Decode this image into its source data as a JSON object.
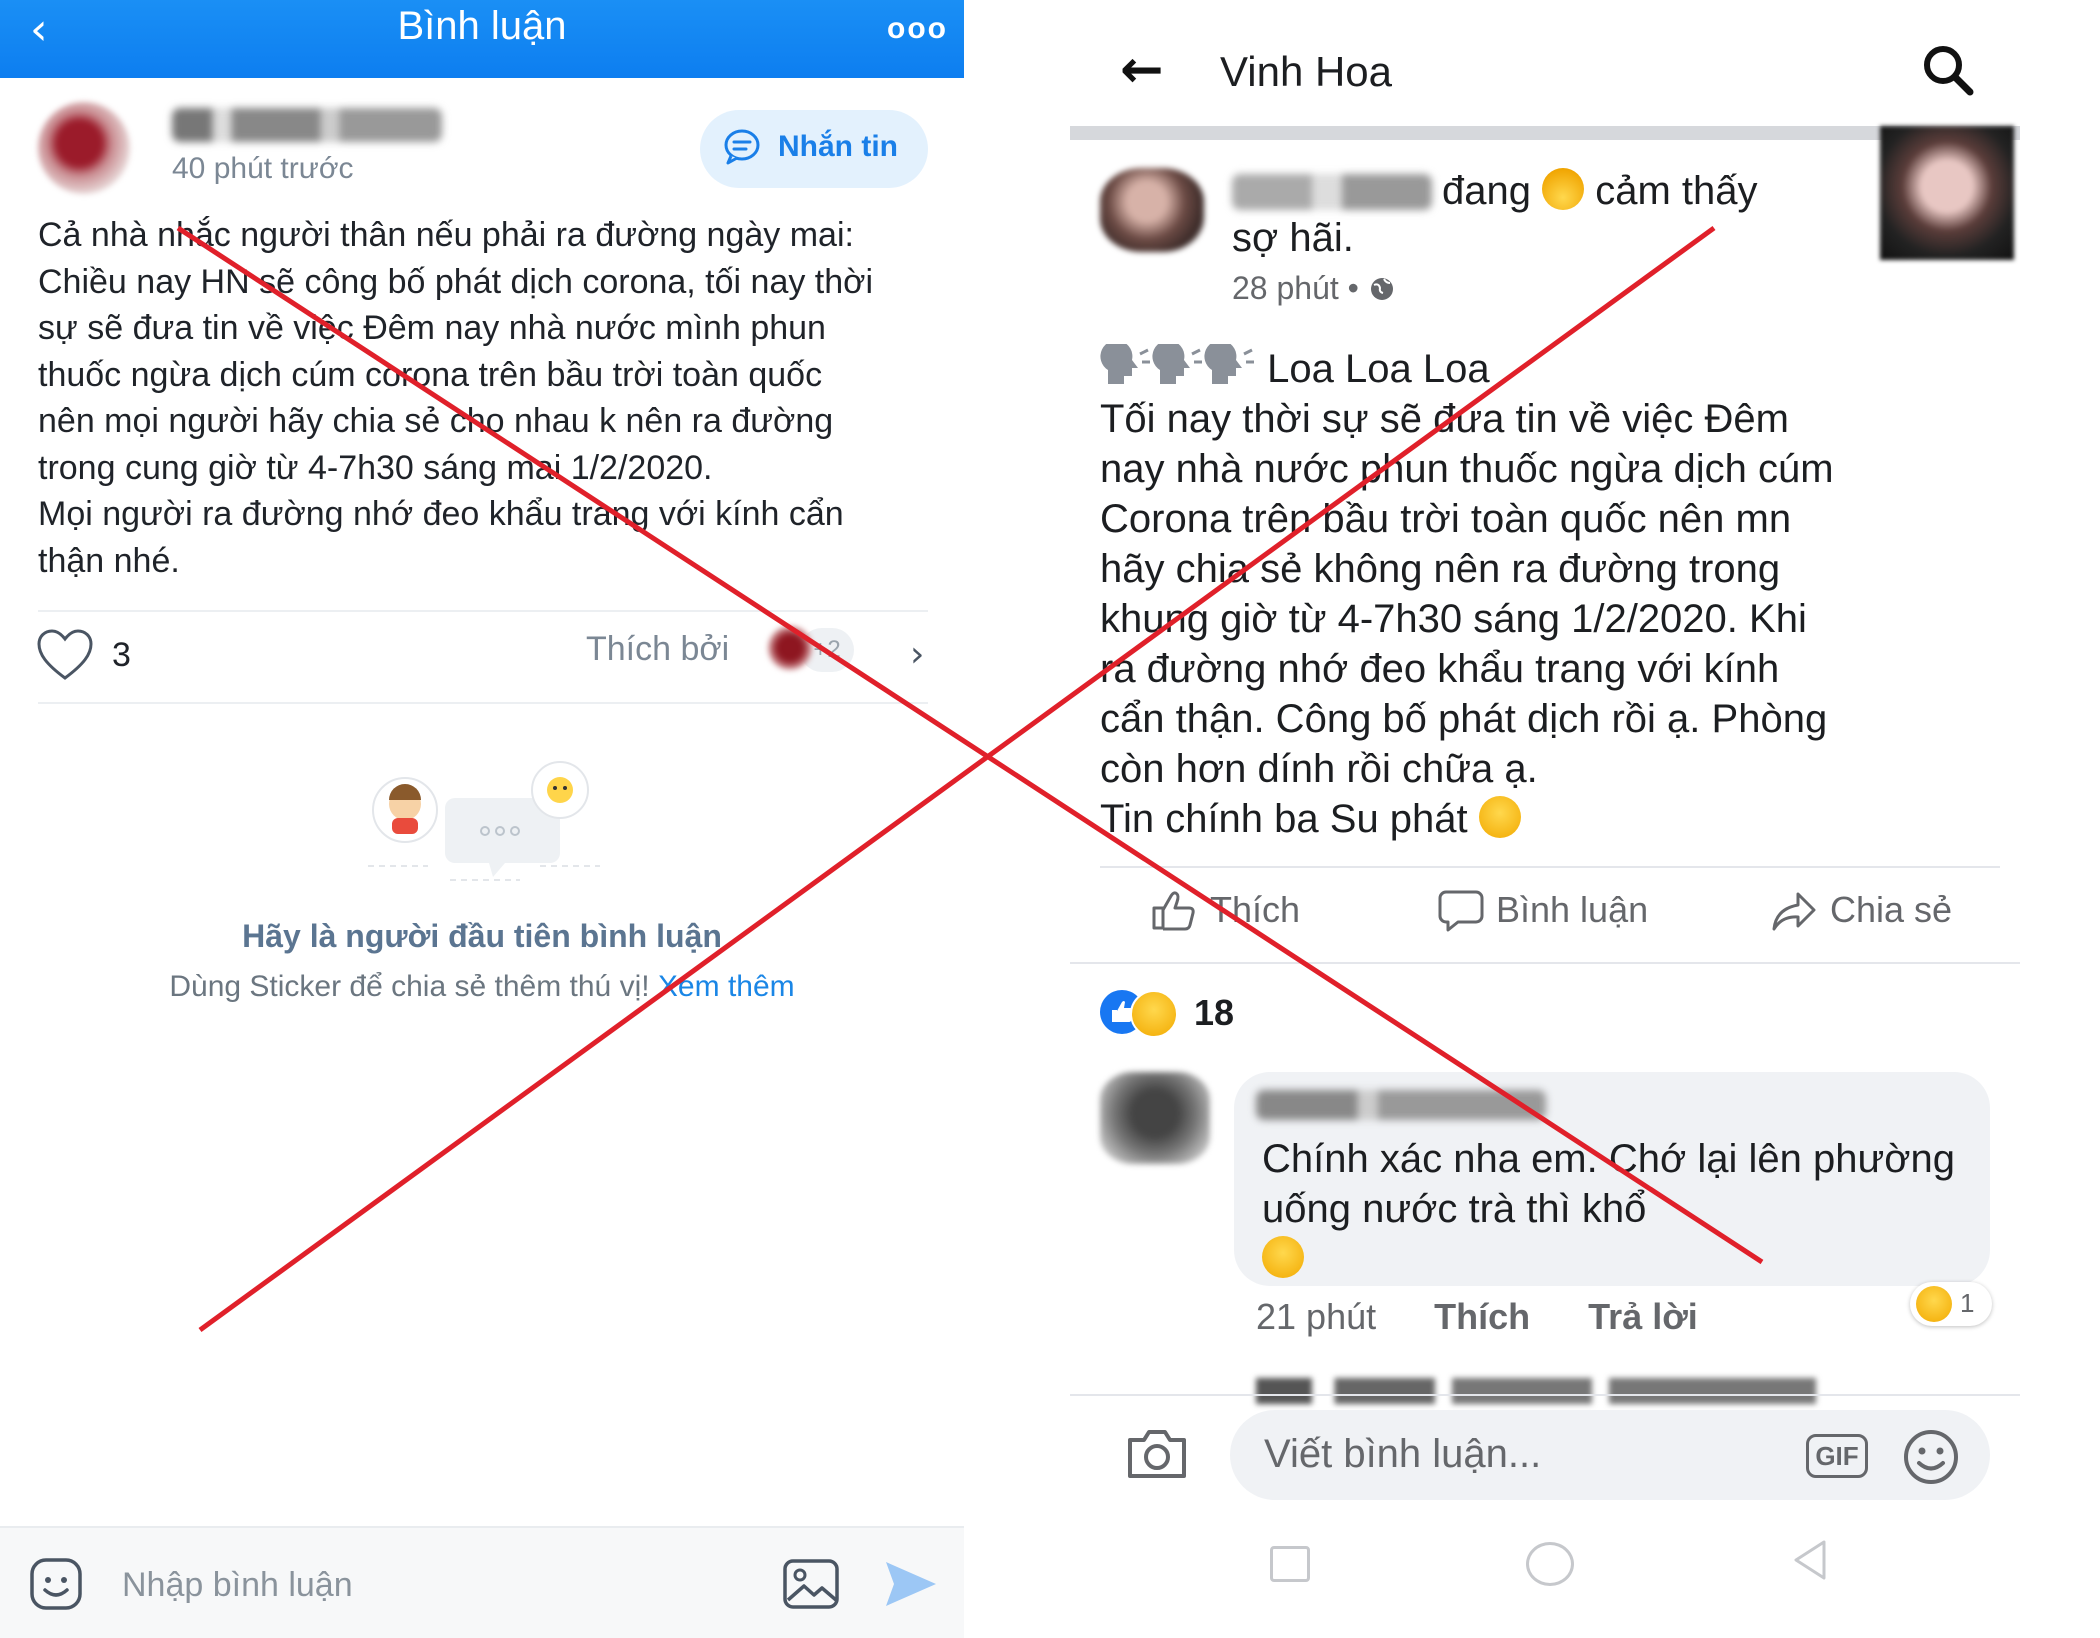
{
  "left_panel": {
    "header": {
      "back_glyph": "‹",
      "title": "Bình luận",
      "more_glyph": "ooo"
    },
    "post": {
      "time": "40 phút trước",
      "message_button_label": "Nhắn tin",
      "body": "Cả nhà nhắc người thân nếu phải ra đường ngày mai:\nChiều nay HN sẽ công bố phát dịch corona, tối nay thời\nsự sẽ đưa tin về việc Đêm nay nhà nước mình phun\nthuốc ngừa dịch cúm corona trên bầu trời toàn quốc\nnên mọi người hãy chia sẻ cho nhau k nên ra đường\ntrong cung giờ từ 4-7h30 sáng mai 1/2/2020.\nMọi người ra đường nhớ đeo khẩu trang với kính cẩn\nthận nhé.",
      "like_count": "3",
      "liked_by_label": "Thích bởi",
      "liked_by_more": "+2",
      "chevron_glyph": "›"
    },
    "empty_state": {
      "title": "Hãy là người đầu tiên bình luận",
      "subtitle": "Dùng Sticker để chia sẻ thêm thú vị!",
      "link": "Xem thêm"
    },
    "footer": {
      "input_placeholder": "Nhập bình luận"
    }
  },
  "right_panel": {
    "header": {
      "back_glyph": "←",
      "title": "Vinh Hoa"
    },
    "post": {
      "status_prefix": "đang",
      "status_feeling": "cảm thấy",
      "status_line2": "sợ hãi.",
      "time": "28 phút •",
      "heading": "Loa Loa Loa",
      "body_lines": [
        "Tối nay thời sự sẽ đưa tin về việc Đêm",
        "nay nhà nước phun thuốc ngừa dịch cúm",
        "Corona trên bầu trời toàn quốc nên mn",
        "hãy chia sẻ không nên ra đường trong",
        "khung giờ từ 4-7h30 sáng 1/2/2020.  Khi",
        "ra đường nhớ đeo khẩu trang với kính",
        "cẩn thận. Công bố phát dịch rồi ạ. Phòng",
        "còn hơn dính rồi chữa ạ.",
        "Tin chính ba Su phát"
      ],
      "actions": {
        "like": "Thích",
        "comment": "Bình luận",
        "share": "Chia sẻ"
      },
      "reaction_count": "18"
    },
    "comment": {
      "text": "Chính xác nha em. Chớ lại lên phường uống nước trà thì khổ",
      "time": "21 phút",
      "like": "Thích",
      "reply": "Trả lời",
      "reaction_count": "1"
    },
    "composer": {
      "placeholder": "Viết bình luận...",
      "gif_label": "GIF"
    }
  },
  "overlay": {
    "color": "#e0202a"
  },
  "colors": {
    "zalo_blue": "#0d7ef0",
    "facebook_blue": "#1877f2"
  }
}
